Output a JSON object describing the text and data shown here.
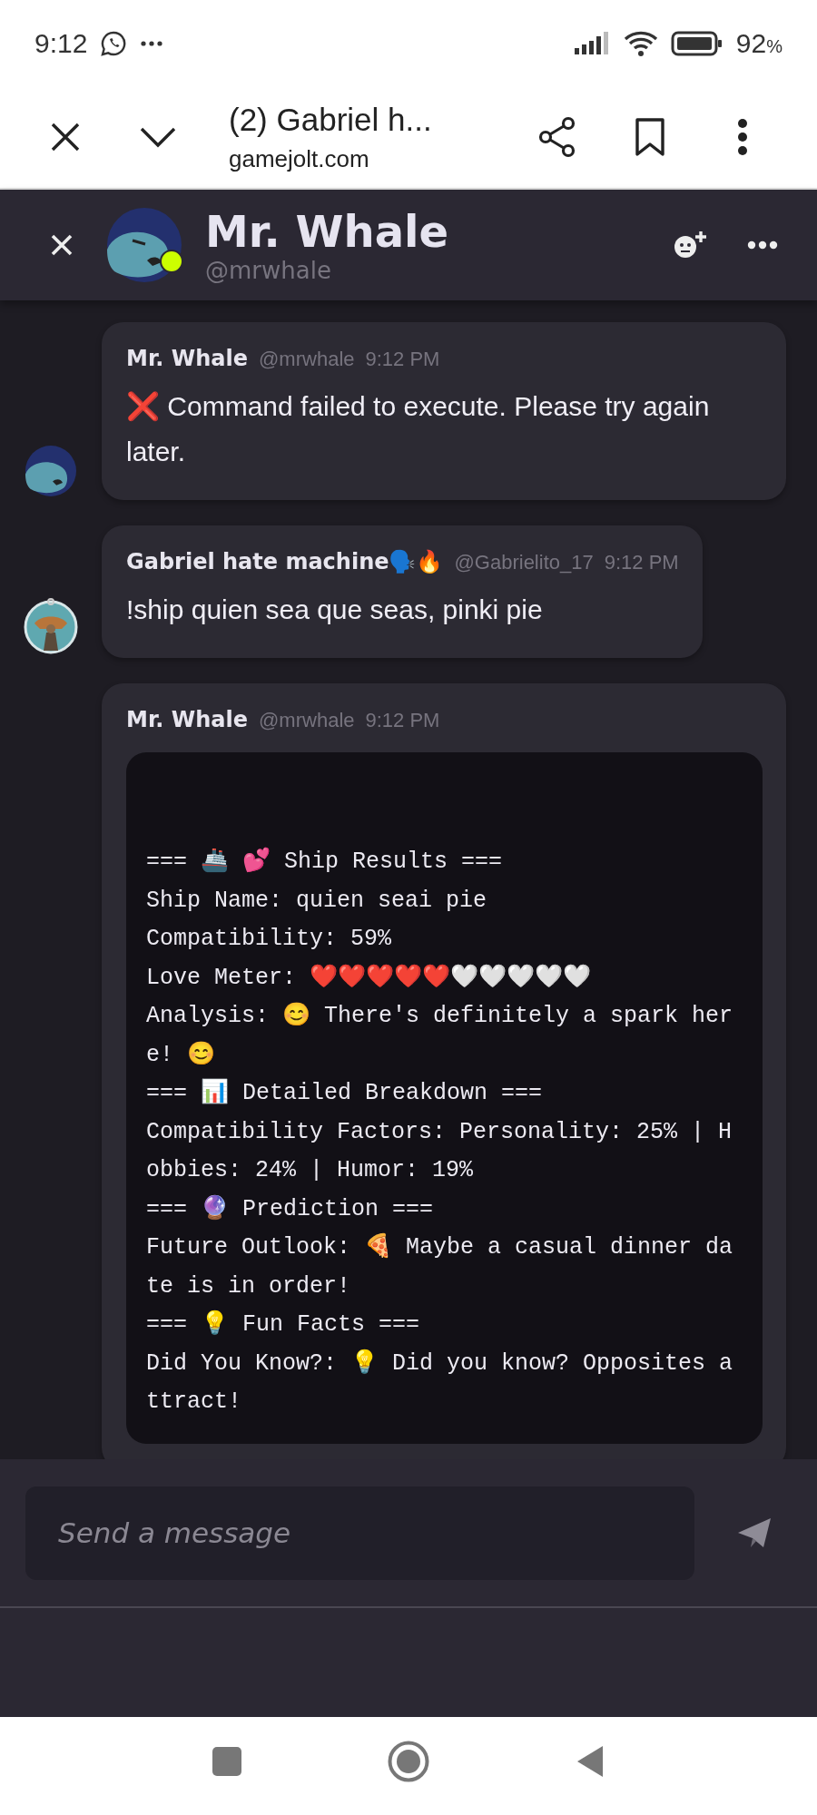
{
  "status_bar": {
    "time": "9:12",
    "battery": "92",
    "battery_unit": "%"
  },
  "browser_bar": {
    "title": "(2) Gabriel h...",
    "url": "gamejolt.com"
  },
  "chat_header": {
    "name": "Mr. Whale",
    "handle": "@mrwhale",
    "online": true
  },
  "messages": [
    {
      "author": "Mr. Whale",
      "handle": "@mrwhale",
      "time": "9:12 PM",
      "avatar": {
        "kind": "whale"
      },
      "kind": "text",
      "body": "❌ Command failed to execute. Please try again later."
    },
    {
      "author": "Gabriel hate machine🗣️🔥",
      "handle": "@Gabrielito_17",
      "time": "9:12 PM",
      "avatar": {
        "kind": "other"
      },
      "kind": "text",
      "body": "!ship quien sea que seas, pinki pie"
    },
    {
      "author": "Mr. Whale",
      "handle": "@mrwhale",
      "time": "9:12 PM",
      "kind": "code",
      "code_lines": [
        "=== 🚢 💕 Ship Results ===",
        "Ship Name: quien seai pie",
        "Compatibility: 59%",
        "Love Meter: ❤️❤️❤️❤️❤️🤍🤍🤍🤍🤍",
        "Analysis: 😊 There's definitely a spark her",
        "e! 😊",
        "=== 📊 Detailed Breakdown ===",
        "Compatibility Factors: Personality: 25% | H",
        "obbies: 24% | Humor: 19%",
        "=== 🔮 Prediction ===",
        "Future Outlook: 🍕 Maybe a casual dinner da",
        "te is in order!",
        "=== 💡 Fun Facts ===",
        "Did You Know?: 💡 Did you know? Opposites a",
        "ttract!"
      ]
    }
  ],
  "composer": {
    "placeholder": "Send a message"
  }
}
